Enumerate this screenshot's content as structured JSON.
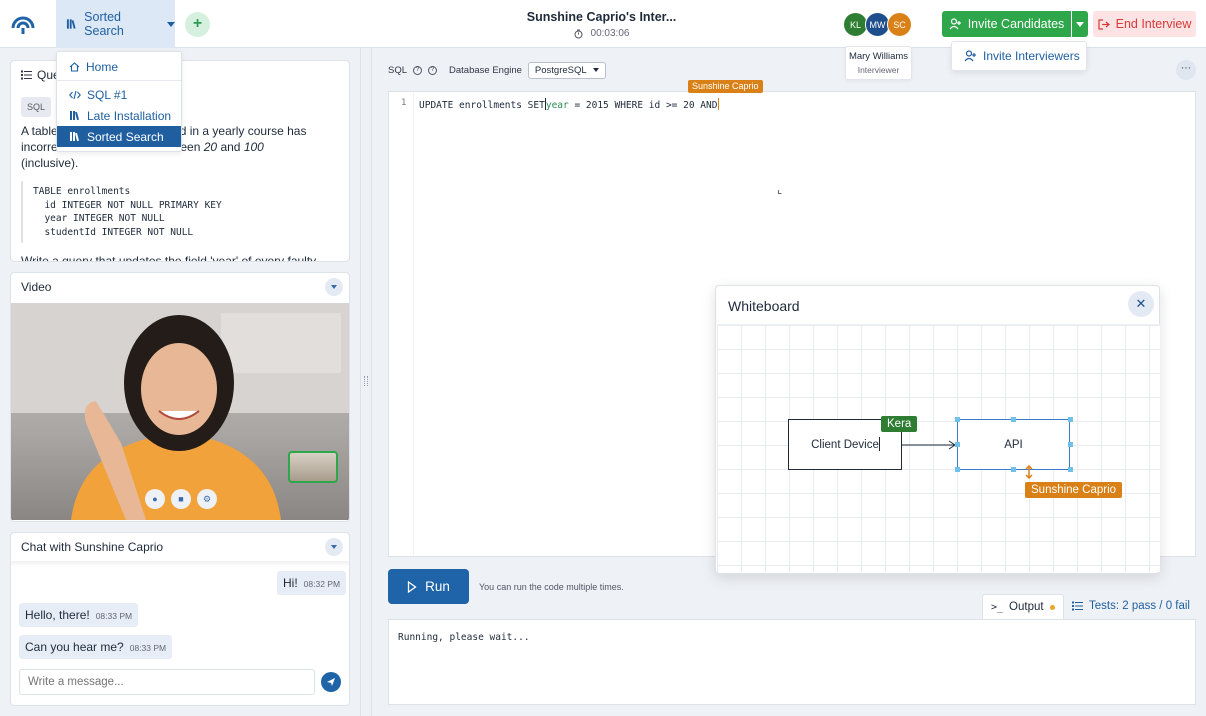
{
  "header": {
    "current_question": "Sorted Search",
    "session_title": "Sunshine Caprio's Inter...",
    "timer": "00:03:06",
    "participants": [
      {
        "initials": "KL",
        "color": "#2e7d32"
      },
      {
        "initials": "MW",
        "color": "#1f4e8c"
      },
      {
        "initials": "SC",
        "color": "#d98016"
      }
    ],
    "tooltip": {
      "name": "Mary Williams",
      "role": "Interviewer"
    },
    "invite_candidates_label": "Invite Candidates",
    "invite_interviewers_label": "Invite Interviewers",
    "end_interview_label": "End Interview"
  },
  "question_menu": {
    "home": "Home",
    "items": [
      "SQL #1",
      "Late Installation",
      "Sorted Search"
    ]
  },
  "question_panel": {
    "heading": "Que",
    "tag": "SQL",
    "text_part1": "A table",
    "text_part1b": "enrolled in a yearly course has",
    "text_part2": "incorre",
    "text_part2b": "s between",
    "num_a": "20",
    "and_word": "and",
    "num_b": "100",
    "text_part3": "(inclusive).",
    "schema": "TABLE enrollments\n  id INTEGER NOT NULL PRIMARY KEY\n  year INTEGER NOT NULL\n  studentId INTEGER NOT NULL",
    "tail": "Write a query that updates the field 'year' of every faulty record"
  },
  "video_panel": {
    "title": "Video"
  },
  "chat_panel": {
    "title": "Chat with Sunshine Caprio",
    "messages": [
      {
        "text": "Hi!",
        "time": "08:32 PM",
        "side": "right"
      },
      {
        "text": "Hello, there!",
        "time": "08:33 PM",
        "side": "left"
      },
      {
        "text": "Can you hear me?",
        "time": "08:33 PM",
        "side": "left"
      }
    ],
    "placeholder": "Write a message..."
  },
  "editor": {
    "language": "SQL",
    "engine_label": "Database Engine",
    "engine": "PostgreSQL",
    "line_number": "1",
    "code_a": "UPDATE enrollments SET",
    "code_b": "year",
    "code_c": " = 2015 WHERE id >= 20 AND",
    "peer_cursor": "Sunshine Caprio"
  },
  "whiteboard": {
    "title": "Whiteboard",
    "node_client": "Client Device",
    "node_api": "API",
    "cursor_kera": "Kera",
    "cursor_sunshine": "Sunshine Caprio"
  },
  "run": {
    "label": "Run",
    "hint": "You can run the code multiple times."
  },
  "output": {
    "tab_label": "Output",
    "tests_label": "Tests: 2 pass / 0 fail",
    "text": "Running, please wait..."
  }
}
